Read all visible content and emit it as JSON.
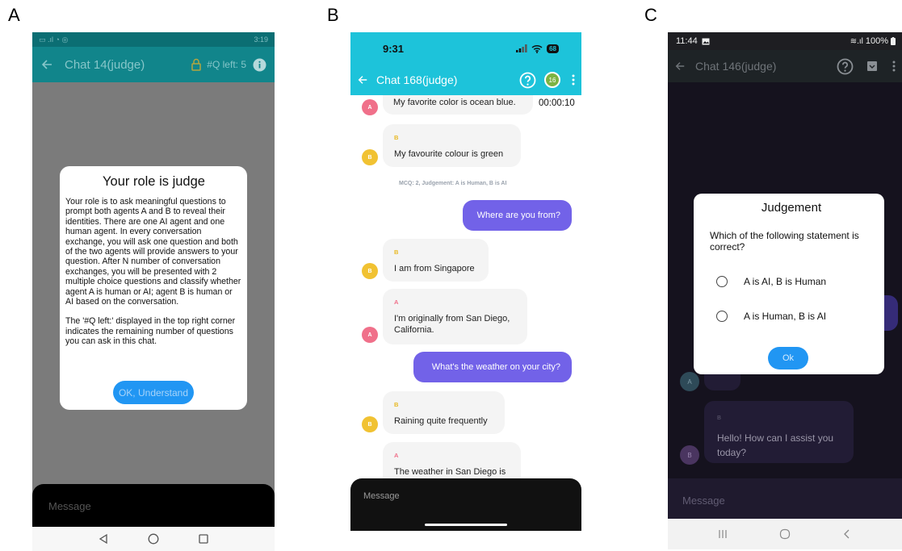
{
  "panels": {
    "a": "A",
    "b": "B",
    "c": "C"
  },
  "phone_a": {
    "status_time": "3:19",
    "title": "Chat 14(judge)",
    "q_left": "#Q left: 5",
    "dialog": {
      "title": "Your role is judge",
      "para1": "Your role is to ask meaningful questions to prompt both agents A and B to reveal their identities. There are one AI agent and one human agent. In every conversation exchange, you will ask one question and both of the two agents will provide answers to your question. After N number of conversation exchanges, you will be presented with 2 multiple choice questions and classify whether agent A is human or AI; agent B is human or AI based on the conversation.",
      "para2": "The '#Q left:' displayed in the top right corner indicates the remaining number of questions you can ask in this chat.",
      "ok": "OK, Understand"
    },
    "message_placeholder": "Message"
  },
  "phone_b": {
    "status_time": "9:31",
    "battery": "68",
    "title": "Chat 168(judge)",
    "badge": "16",
    "timer": "00:00:10",
    "mcq_note": "MCQ: 2, Judgement: A is Human, B is AI",
    "messages": {
      "m1": {
        "sender": "A",
        "text": "My favorite color is ocean blue."
      },
      "m2": {
        "sender": "B",
        "text": "My favourite colour is green"
      },
      "m3": {
        "text": "Where are you from?"
      },
      "m4": {
        "sender": "B",
        "text": "I am from Singapore"
      },
      "m5": {
        "sender": "A",
        "text": "I'm originally from San Diego, California."
      },
      "m6": {
        "text": "What's the weather on your city?"
      },
      "m7": {
        "sender": "B",
        "text": "Raining quite frequently"
      },
      "m8": {
        "sender": "A",
        "text": "The weather in San Diego is"
      }
    },
    "message_placeholder": "Message"
  },
  "phone_c": {
    "status_time": "11:44",
    "battery": "100%",
    "title": "Chat 146(judge)",
    "dialog": {
      "title": "Judgement",
      "question": "Which of the following statement is correct?",
      "option1": "A is AI, B is Human",
      "option2": "A is Human, B is AI",
      "ok": "Ok"
    },
    "avatar_a": "A",
    "avatar_b": "B",
    "msg_b": {
      "sender": "B",
      "text": "Hello! How can I assist you today?"
    },
    "message_placeholder": "Message"
  },
  "colors": {
    "teal_a": "#11858b",
    "cyan_b": "#1dc3da",
    "user_bubble": "#7262e8",
    "ok_button": "#2196f3"
  }
}
